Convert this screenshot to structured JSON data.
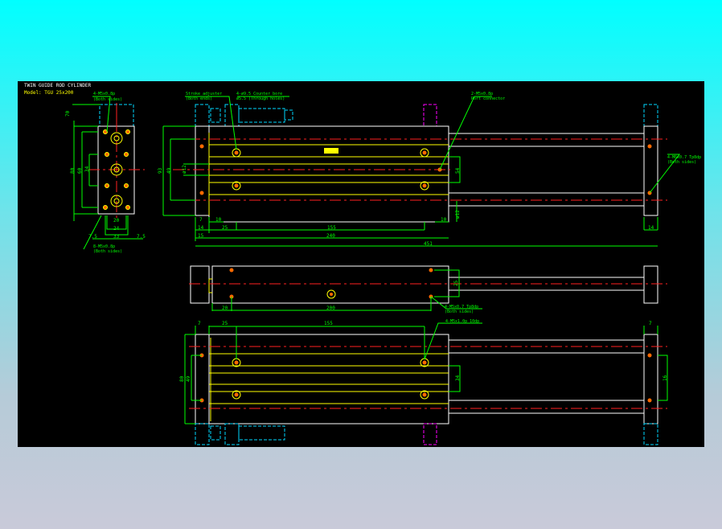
{
  "title": "TWIN GUIDE ROD CYLINDER",
  "model": "Model: TGU 25x200",
  "colors": {
    "background_top": "#00ffff",
    "background_bottom": "#c9cad9",
    "canvas": "#000000",
    "outline": "#ffffff",
    "dimension": "#00ff00",
    "centerline": "#ff2020",
    "hidden": "#00d8ff",
    "sensor": "#ff00ff",
    "inner": "#ffff00"
  },
  "notes": {
    "side_top": [
      "4-M5x0.8p",
      "(Both sides)"
    ],
    "side_bottom": [
      "8-M5x0.8p",
      "(Both sides)"
    ],
    "stroke_adjuster": [
      "Stroke adjuster",
      "(Both ends)"
    ],
    "counter_bore": [
      "4-ø9.5 Counter bore",
      "ø5.5 (Through holes)"
    ],
    "port": [
      "2-M5x0.8p",
      "Port connector"
    ],
    "rod_end": [
      "4-M6x0.7 Tp8dp",
      "(Both sides)"
    ],
    "mid_holes": [
      "4-M5x0.7 Tp8dp",
      "(Both sides)"
    ],
    "bottom_holes": [
      "4-M5x1.0p 10dp"
    ]
  },
  "dims": {
    "side": {
      "h70": "70",
      "h80": "80",
      "h60": "60",
      "h34": "34",
      "w20": "20",
      "w24": "24",
      "w33": "33",
      "w7_5a": "7.5",
      "w7_5b": "7.5"
    },
    "top": {
      "h93": "93",
      "h49": "49",
      "phi12": "ø12",
      "h54": "54",
      "phi2": "ø12",
      "d7": "7",
      "d10a": "10",
      "d10b": "10",
      "d14a": "14",
      "d14b": "14",
      "d25": "25",
      "d155": "155",
      "d15": "15",
      "d240": "240",
      "d451": "451"
    },
    "middle": {
      "d20": "20",
      "d200": "200",
      "h25": "25"
    },
    "bottom": {
      "d7a": "7",
      "d7b": "7",
      "d25": "25",
      "d155": "155",
      "h80": "80",
      "h49": "49",
      "h34": "34",
      "h16": "16"
    }
  }
}
